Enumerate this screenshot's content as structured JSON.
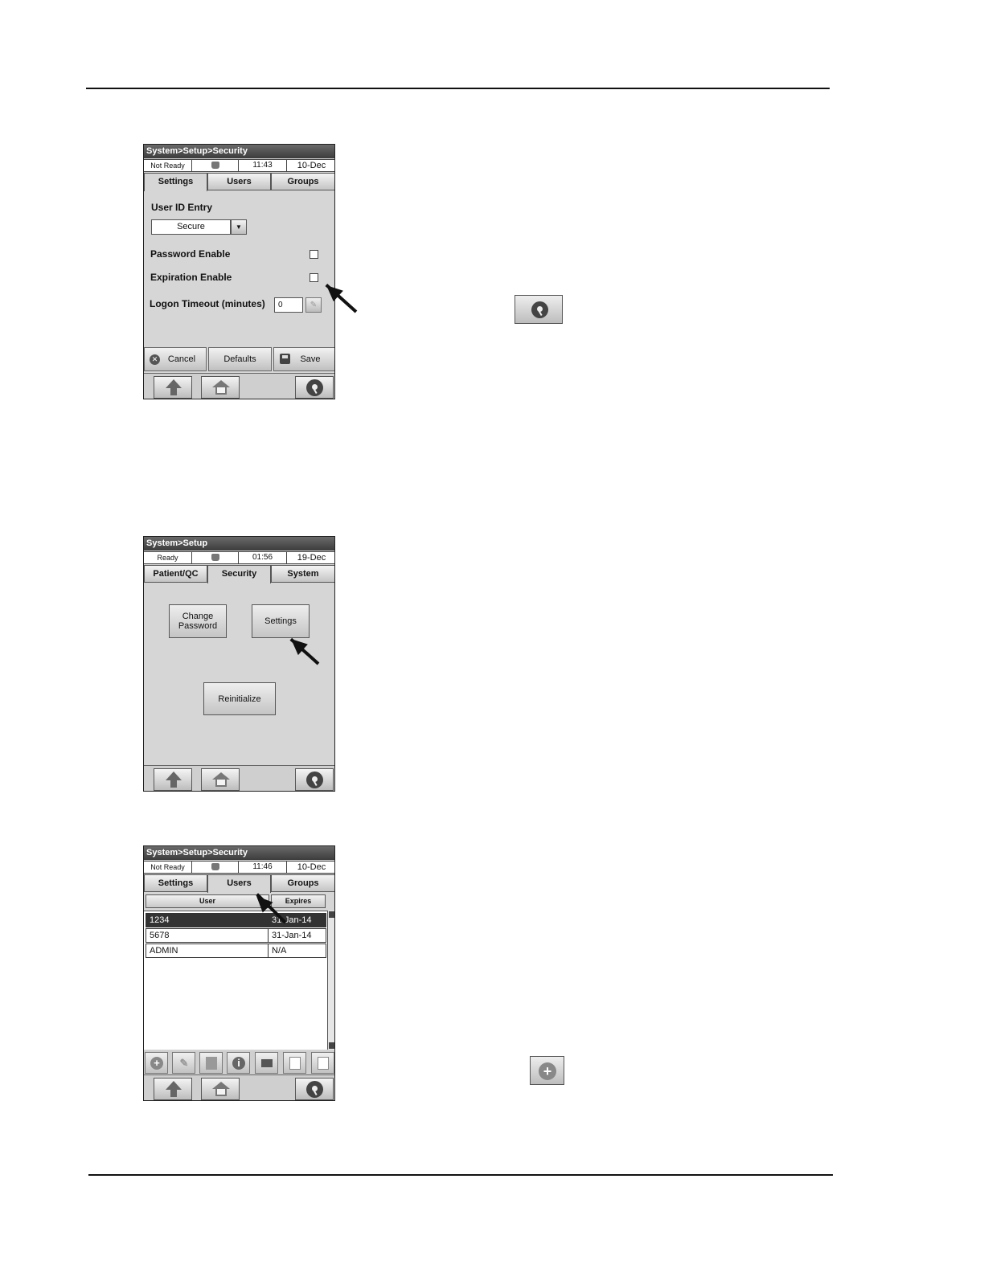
{
  "screen1": {
    "title": "System>Setup>Security",
    "status": "Not Ready",
    "time": "11:43",
    "date": "10-Dec",
    "tabs": [
      "Settings",
      "Users",
      "Groups"
    ],
    "active_tab": "Settings",
    "user_id_entry_label": "User ID Entry",
    "user_id_entry_value": "Secure",
    "password_enable_label": "Password Enable",
    "password_enable_checked": false,
    "expiration_enable_label": "Expiration Enable",
    "expiration_enable_checked": false,
    "logon_timeout_label": "Logon Timeout (minutes)",
    "logon_timeout_value": "0",
    "cancel_label": "Cancel",
    "defaults_label": "Defaults",
    "save_label": "Save"
  },
  "screen2": {
    "title": "System>Setup",
    "status": "Ready",
    "time": "01:56",
    "date": "19-Dec",
    "tabs": [
      "Patient/QC",
      "Security",
      "System"
    ],
    "active_tab": "Security",
    "change_password_label": "Change Password",
    "settings_label": "Settings",
    "reinitialize_label": "Reinitialize"
  },
  "screen3": {
    "title": "System>Setup>Security",
    "status": "Not Ready",
    "time": "11:46",
    "date": "10-Dec",
    "tabs": [
      "Settings",
      "Users",
      "Groups"
    ],
    "active_tab": "Users",
    "columns": [
      "User",
      "Expires"
    ],
    "rows": [
      {
        "user": "1234",
        "expires": "31-Jan-14",
        "selected": true
      },
      {
        "user": "5678",
        "expires": "31-Jan-14",
        "selected": false
      },
      {
        "user": "ADMIN",
        "expires": "N/A",
        "selected": false
      }
    ],
    "toolbar_icons": [
      "add-icon",
      "edit-icon",
      "delete-icon",
      "info-icon",
      "print-icon",
      "import-icon",
      "export-icon"
    ]
  },
  "nav_icons": [
    "up-arrow-icon",
    "home-icon",
    "key-icon"
  ],
  "callout_icons": [
    "key-icon",
    "add-icon"
  ]
}
